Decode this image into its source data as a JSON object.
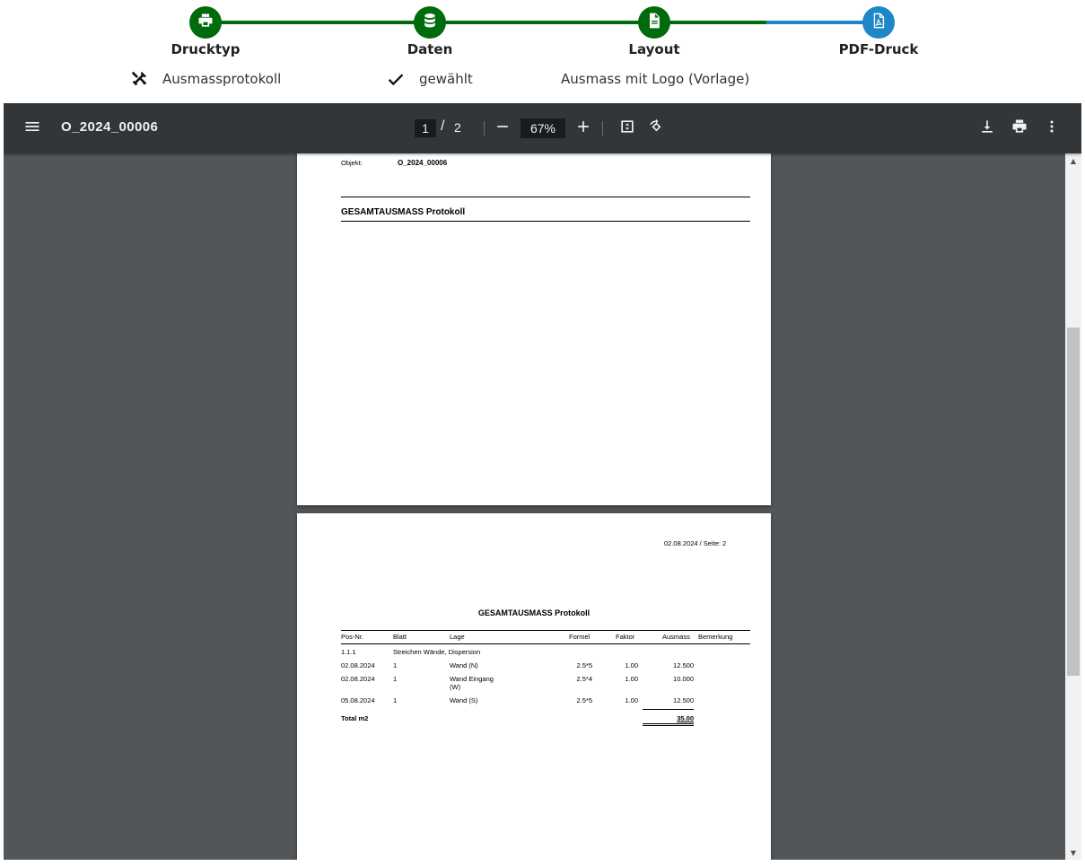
{
  "colors": {
    "done": "#006b0c",
    "active": "#1e88c7",
    "toolbar": "#323639",
    "viewer_bg": "#525659"
  },
  "stepper": {
    "steps": [
      {
        "title": "Drucktyp",
        "icon": "printer-icon",
        "sub_icon": "tools-icon",
        "sub": "Ausmassprotokoll"
      },
      {
        "title": "Daten",
        "icon": "database-icon",
        "sub_icon": "check-icon",
        "sub": "gewählt"
      },
      {
        "title": "Layout",
        "icon": "document-icon",
        "sub": "Ausmass mit Logo (Vorlage)"
      },
      {
        "title": "PDF-Druck",
        "icon": "pdf-icon",
        "sub": ""
      }
    ]
  },
  "viewer": {
    "title": "O_2024_00006",
    "current_page": "1",
    "page_separator": "/",
    "total_pages": "2",
    "zoom": "67%",
    "icons": [
      "menu-icon",
      "zoom-out-icon",
      "zoom-in-icon",
      "fit-page-icon",
      "rotate-icon",
      "download-icon",
      "print-icon",
      "more-vert-icon"
    ]
  },
  "page1": {
    "objekt_label": "Objekt:",
    "objekt_value": "O_2024_00006",
    "heading": "GESAMTAUSMASS Protokoll"
  },
  "page2": {
    "date_page": "02.08.2024 / Seite: 2",
    "heading": "GESAMTAUSMASS Protokoll",
    "columns": {
      "pos": "Pos-Nr.",
      "blatt": "Blatt",
      "lage": "Lage",
      "formel": "Formel",
      "faktor": "Faktor",
      "ausmass": "Ausmass",
      "bemerkung": "Bemerkung"
    },
    "group": {
      "pos": "1.1.1",
      "desc": "Streichen Wände, Dispersion"
    },
    "rows": [
      {
        "pos": "02.08.2024",
        "blatt": "1",
        "lage": "Wand (N)",
        "lage2": "",
        "formel": "2.5*5",
        "faktor": "1.00",
        "ausmass": "12.500"
      },
      {
        "pos": "02.08.2024",
        "blatt": "1",
        "lage": "Wand Eingang",
        "lage2": "(W)",
        "formel": "2.5*4",
        "faktor": "1.00",
        "ausmass": "10.000"
      },
      {
        "pos": "05.08.2024",
        "blatt": "1",
        "lage": "Wand (S)",
        "lage2": "",
        "formel": "2.5*5",
        "faktor": "1.00",
        "ausmass": "12.500"
      }
    ],
    "total_label": "Total m2",
    "total_value": "35.00"
  }
}
